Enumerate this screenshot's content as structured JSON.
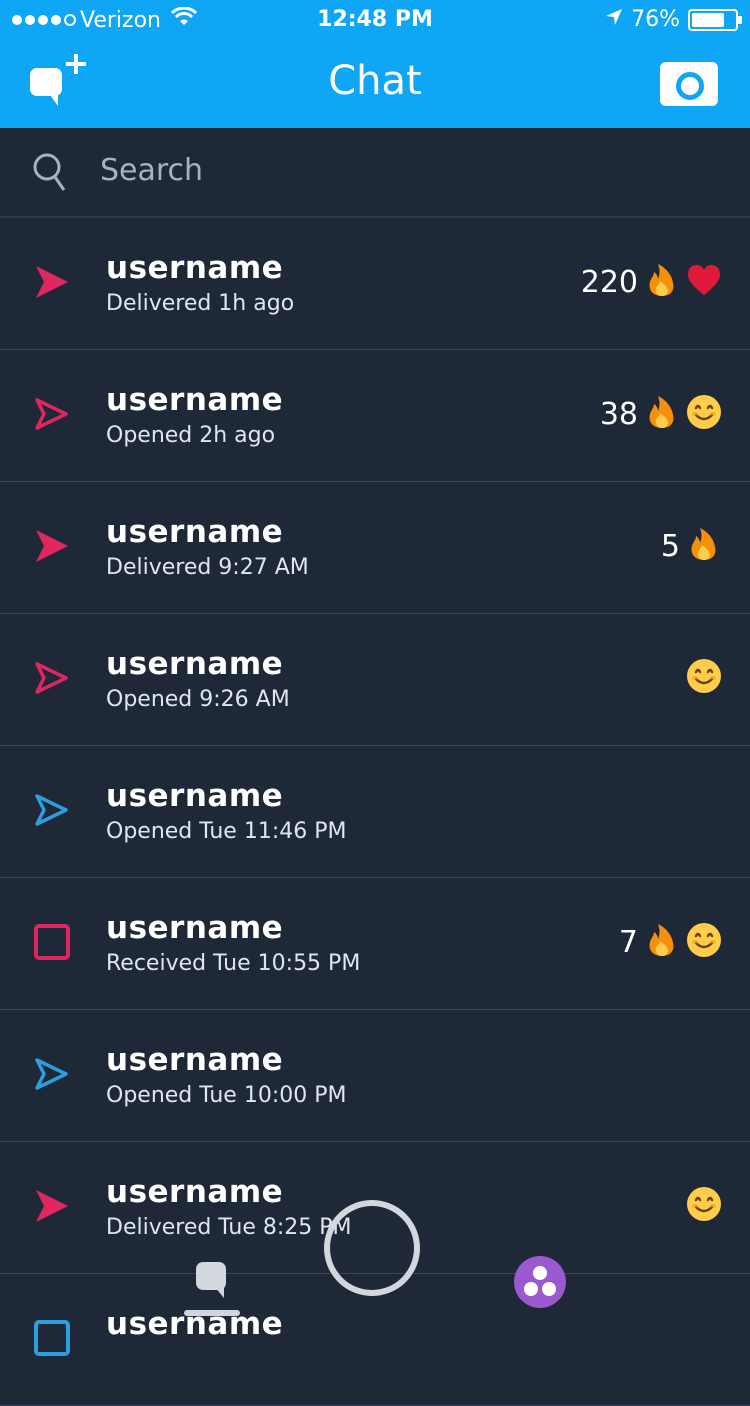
{
  "status_bar": {
    "carrier": "Verizon",
    "time": "12:48 PM",
    "battery": "76%",
    "battery_level": 0.76
  },
  "header": {
    "title": "Chat",
    "new_chat_icon": "new-chat-icon",
    "camera_icon": "camera-icon"
  },
  "search": {
    "placeholder": "Search",
    "icon": "search-icon"
  },
  "colors": {
    "header_blue": "#0fa7f5",
    "background": "#1f2837",
    "snap_red": "#e0265e",
    "chat_blue": "#2d9ee0",
    "divider": "#34455f",
    "stories_purple": "#9b59d0"
  },
  "chats": [
    {
      "username": "username",
      "status": "Delivered 1h ago",
      "icon": "delivered-snap-icon",
      "streak": "220",
      "emojis": [
        "fire",
        "heart"
      ]
    },
    {
      "username": "username",
      "status": "Opened 2h ago",
      "icon": "opened-snap-icon",
      "streak": "38",
      "emojis": [
        "fire",
        "smile"
      ]
    },
    {
      "username": "username",
      "status": "Delivered 9:27 AM",
      "icon": "delivered-snap-icon",
      "streak": "5",
      "emojis": [
        "fire"
      ]
    },
    {
      "username": "username",
      "status": "Opened 9:26 AM",
      "icon": "opened-snap-icon",
      "streak": "",
      "emojis": [
        "smile"
      ]
    },
    {
      "username": "username",
      "status": "Opened Tue 11:46 PM",
      "icon": "opened-chat-icon",
      "streak": "",
      "emojis": []
    },
    {
      "username": "username",
      "status": "Received Tue 10:55 PM",
      "icon": "received-snap-icon",
      "streak": "7",
      "emojis": [
        "fire",
        "smile"
      ]
    },
    {
      "username": "username",
      "status": "Opened Tue 10:00 PM",
      "icon": "opened-chat-icon",
      "streak": "",
      "emojis": []
    },
    {
      "username": "username",
      "status": "Delivered Tue 8:25 PM",
      "icon": "delivered-snap-icon",
      "streak": "",
      "emojis": [
        "smile"
      ]
    },
    {
      "username": "username",
      "status": "",
      "icon": "received-chat-icon",
      "streak": "",
      "emojis": []
    }
  ],
  "bottom_nav": {
    "chat_icon": "chat-nav-icon",
    "capture_icon": "capture-button-icon",
    "stories_icon": "stories-icon"
  }
}
